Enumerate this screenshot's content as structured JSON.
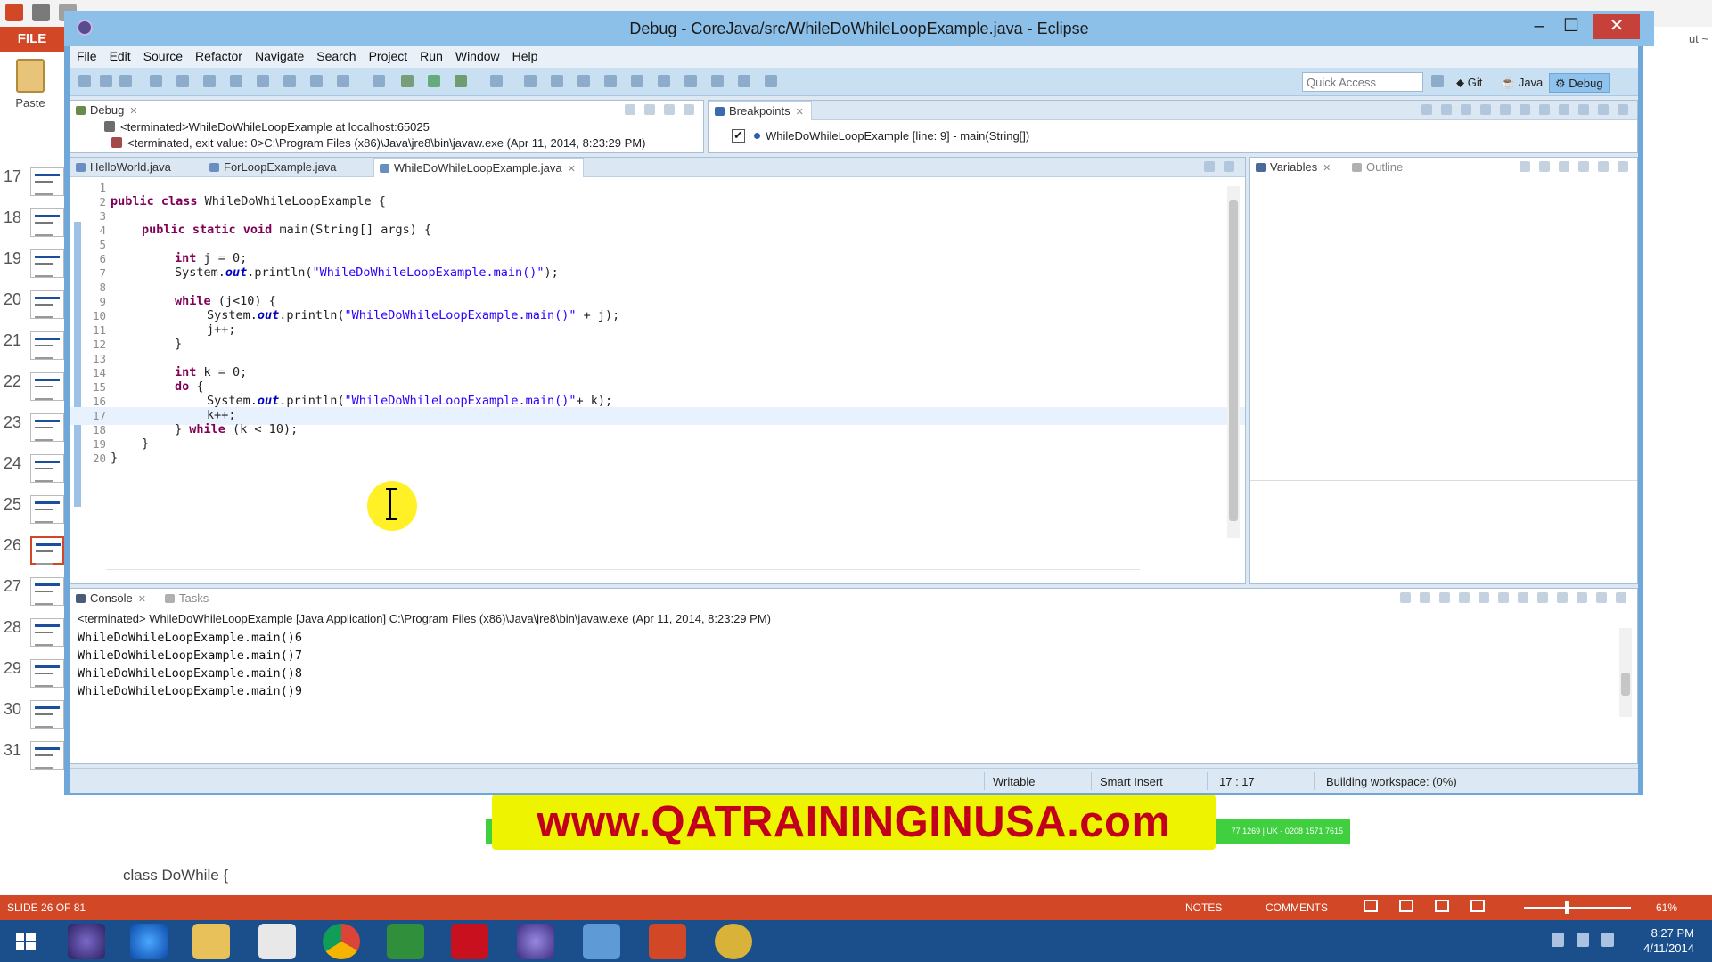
{
  "powerpoint": {
    "file_tab": "FILE",
    "paste_label": "Paste",
    "corner_text": "ut ~",
    "slides": [
      {
        "num": "17"
      },
      {
        "num": "18"
      },
      {
        "num": "19"
      },
      {
        "num": "20"
      },
      {
        "num": "21"
      },
      {
        "num": "22"
      },
      {
        "num": "23"
      },
      {
        "num": "24"
      },
      {
        "num": "25"
      },
      {
        "num": "26"
      },
      {
        "num": "27"
      },
      {
        "num": "28"
      },
      {
        "num": "29"
      },
      {
        "num": "30"
      },
      {
        "num": "31"
      }
    ],
    "active_slide": "26",
    "notes_text": "class DoWhile {",
    "status": {
      "slide_info": "SLIDE 26 OF 81",
      "notes": "NOTES",
      "comments": "COMMENTS",
      "zoom": "61%"
    }
  },
  "taskbar": {
    "time": "8:27 PM",
    "date": "4/11/2014"
  },
  "eclipse": {
    "title": "Debug - CoreJava/src/WhileDoWhileLoopExample.java - Eclipse",
    "menu": [
      "File",
      "Edit",
      "Source",
      "Refactor",
      "Navigate",
      "Search",
      "Project",
      "Run",
      "Window",
      "Help"
    ],
    "quick_access_placeholder": "Quick Access",
    "perspectives": [
      "Git",
      "Java",
      "Debug"
    ],
    "debug_view": {
      "tab": "Debug",
      "lines": [
        "<terminated>WhileDoWhileLoopExample at localhost:65025",
        "<terminated, exit value: 0>C:\\Program Files (x86)\\Java\\jre8\\bin\\javaw.exe (Apr 11, 2014, 8:23:29 PM)"
      ]
    },
    "breakpoints_view": {
      "tab": "Breakpoints",
      "items": [
        "WhileDoWhileLoopExample [line: 9] - main(String[])"
      ]
    },
    "editor_tabs": [
      "HelloWorld.java",
      "ForLoopExample.java",
      "WhileDoWhileLoopExample.java"
    ],
    "side_tabs": [
      "Variables",
      "Outline"
    ],
    "code": {
      "line_numbers": [
        "1",
        "2",
        "3",
        "4",
        "5",
        "6",
        "7",
        "8",
        "9",
        "10",
        "11",
        "12",
        "13",
        "14",
        "15",
        "16",
        "17",
        "18",
        "19",
        "20"
      ],
      "l2_kw": "public class ",
      "l2_rest": "WhileDoWhileLoopExample {",
      "l4_kw": "public static void ",
      "l4_rest": "main(String[] args) {",
      "int": "int ",
      "l6_rest": "j = 0;",
      "sys": "System.",
      "out": "out",
      "println": ".println(",
      "s_main": "\"WhileDoWhileLoopExample.main()\"",
      "l7_end": ");",
      "while": "while ",
      "l9_rest": "(j<10) {",
      "l10_end": " + j);",
      "l11": "j++;",
      "close_brace": "}",
      "l14_rest": "k = 0;",
      "do": "do ",
      "open_brace": "{",
      "l16_end": "+ k);",
      "l17": "k++;",
      "l18_start": "} ",
      "l18_rest": "(k < 10);"
    },
    "console": {
      "tab": "Console",
      "tasks_tab": "Tasks",
      "header": "<terminated> WhileDoWhileLoopExample [Java Application] C:\\Program Files (x86)\\Java\\jre8\\bin\\javaw.exe (Apr 11, 2014, 8:23:29 PM)",
      "lines": [
        "WhileDoWhileLoopExample.main()6",
        "WhileDoWhileLoopExample.main()7",
        "WhileDoWhileLoopExample.main()8",
        "WhileDoWhileLoopExample.main()9"
      ]
    },
    "status": {
      "writable": "Writable",
      "insert_mode": "Smart Insert",
      "position": "17 : 17",
      "build": "Building workspace: (0%)"
    }
  },
  "banner": {
    "text": "www.QATRAININGINUSA.com",
    "small_text": "77 1269 | UK - 0208 1571 7615"
  }
}
